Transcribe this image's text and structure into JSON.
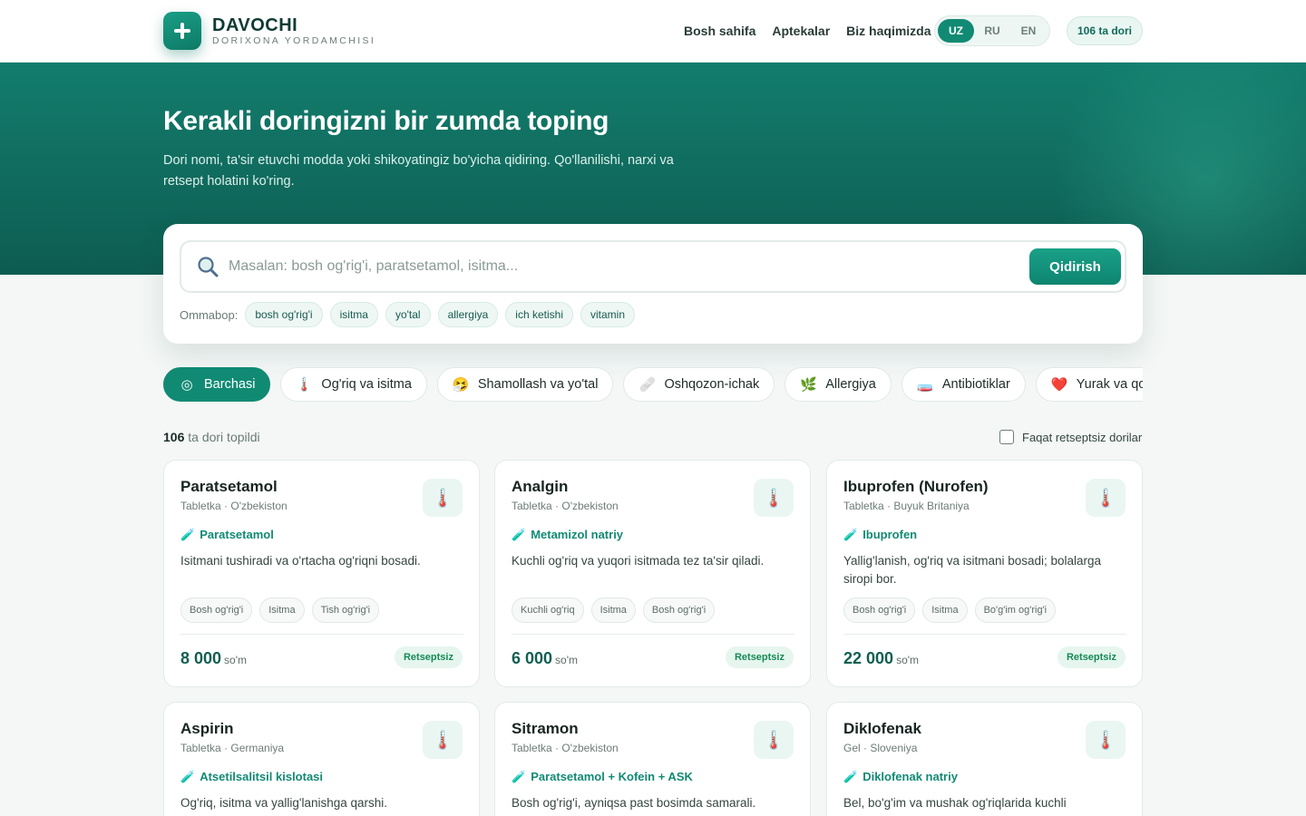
{
  "brand": {
    "title": "DAVOCHI",
    "subtitle": "DORIXONA YORDAMCHISI"
  },
  "nav": {
    "items": [
      "Bosh sahifa",
      "Aptekalar",
      "Biz haqimizda"
    ]
  },
  "lang": {
    "options": [
      "UZ",
      "RU",
      "EN"
    ],
    "active": "UZ"
  },
  "header_badge": "106 ta dori",
  "hero": {
    "title": "Kerakli doringizni bir zumda toping",
    "description": "Dori nomi, ta'sir etuvchi modda yoki shikoyatingiz bo'yicha qidiring. Qo'llanilishi, narxi va retsept holatini ko'ring."
  },
  "search": {
    "placeholder": "Masalan: bosh og'rig'i, paratsetamol, isitma...",
    "button": "Qidirish",
    "popular_label": "Ommabop:",
    "popular": [
      "bosh og'rig'i",
      "isitma",
      "yo'tal",
      "allergiya",
      "ich ketishi",
      "vitamin"
    ]
  },
  "categories": [
    {
      "label": "Barchasi",
      "icon": "target-icon",
      "glyph": "◎",
      "active": true
    },
    {
      "label": "Og'riq va isitma",
      "icon": "thermometer-icon",
      "glyph": "🌡️",
      "active": false
    },
    {
      "label": "Shamollash va yo'tal",
      "icon": "sneezing-face-icon",
      "glyph": "🤧",
      "active": false
    },
    {
      "label": "Oshqozon-ichak",
      "icon": "bandage-icon",
      "glyph": "🩹",
      "active": false
    },
    {
      "label": "Allergiya",
      "icon": "herb-icon",
      "glyph": "🌿",
      "active": false
    },
    {
      "label": "Antibiotiklar",
      "icon": "petri-dish-icon",
      "glyph": "🧫",
      "active": false
    },
    {
      "label": "Yurak va qon bosimi",
      "icon": "heart-icon",
      "glyph": "❤️",
      "active": false
    }
  ],
  "results": {
    "count": "106",
    "text": "ta dori topildi"
  },
  "filter": {
    "label": "Faqat retseptsiz dorilar",
    "checked": false
  },
  "currency": "so'm",
  "drugs": [
    {
      "name": "Paratsetamol",
      "meta": "Tabletka · O'zbekiston",
      "ingredient": "Paratsetamol",
      "description": "Isitmani tushiradi va o'rtacha og'riqni bosadi.",
      "tags": [
        "Bosh og'rig'i",
        "Isitma",
        "Tish og'rig'i"
      ],
      "price": "8 000",
      "badge": "Retseptsiz",
      "icon": "thermometer-icon"
    },
    {
      "name": "Analgin",
      "meta": "Tabletka · O'zbekiston",
      "ingredient": "Metamizol natriy",
      "description": "Kuchli og'riq va yuqori isitmada tez ta'sir qiladi.",
      "tags": [
        "Kuchli og'riq",
        "Isitma",
        "Bosh og'rig'i"
      ],
      "price": "6 000",
      "badge": "Retseptsiz",
      "icon": "thermometer-icon"
    },
    {
      "name": "Ibuprofen (Nurofen)",
      "meta": "Tabletka · Buyuk Britaniya",
      "ingredient": "Ibuprofen",
      "description": "Yallig'lanish, og'riq va isitmani bosadi; bolalarga siropi bor.",
      "tags": [
        "Bosh og'rig'i",
        "Isitma",
        "Bo'g'im og'rig'i"
      ],
      "price": "22 000",
      "badge": "Retseptsiz",
      "icon": "thermometer-icon"
    },
    {
      "name": "Aspirin",
      "meta": "Tabletka · Germaniya",
      "ingredient": "Atsetilsalitsil kislotasi",
      "description": "Og'riq, isitma va yallig'lanishga qarshi.",
      "icon": "thermometer-icon"
    },
    {
      "name": "Sitramon",
      "meta": "Tabletka · O'zbekiston",
      "ingredient": "Paratsetamol + Kofein + ASK",
      "description": "Bosh og'rig'i, ayniqsa past bosimda samarali.",
      "icon": "thermometer-icon"
    },
    {
      "name": "Diklofenak",
      "meta": "Gel · Sloveniya",
      "ingredient": "Diklofenak natriy",
      "description": "Bel, bo'g'im va mushak og'riqlarida kuchli",
      "icon": "thermometer-icon"
    }
  ]
}
